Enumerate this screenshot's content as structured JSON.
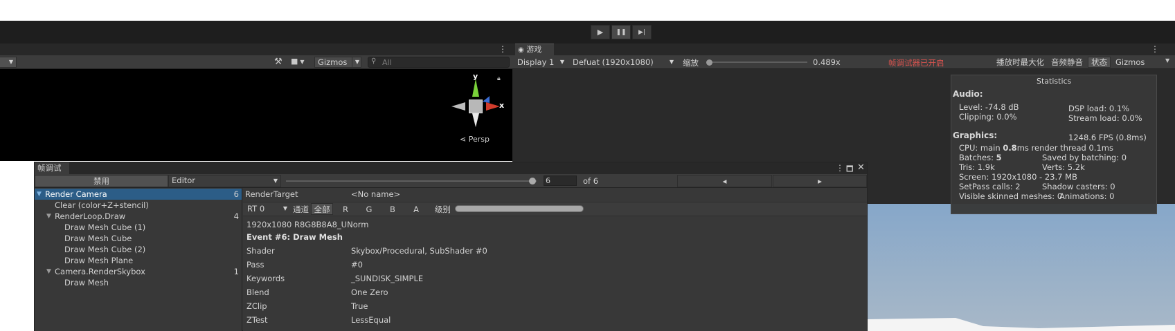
{
  "play_toolbar": {
    "play": "▶",
    "pause": "❚❚",
    "step": "▶|"
  },
  "scene": {
    "gizmos_label": "Gizmos",
    "search_placeholder": "All",
    "axis_y": "y",
    "axis_x": "x",
    "persp_label": "Persp"
  },
  "game": {
    "tab_label": "游戏",
    "display": "Display 1",
    "resolution": "Defuat (1920x1080)",
    "scale_label": "缩放",
    "scale_value": "0.489x",
    "debugger_notice": "帧调试器已开启",
    "maximize": "播放时最大化",
    "mute": "音频静音",
    "stats": "状态",
    "gizmos": "Gizmos",
    "colors": {
      "notice": "#d9534f"
    }
  },
  "statistics": {
    "title": "Statistics",
    "audio_header": "Audio:",
    "level": "Level: -74.8 dB",
    "clipping": "Clipping: 0.0%",
    "dsp_load": "DSP load: 0.1%",
    "stream_load": "Stream load: 0.0%",
    "graphics_header": "Graphics:",
    "fps": "1248.6 FPS (0.8ms)",
    "cpu_prefix": "CPU: main ",
    "cpu_main": "0.8",
    "cpu_suffix": "ms  render thread 0.1ms",
    "batches_prefix": "Batches: ",
    "batches": "5",
    "saved_batching": "Saved by batching: 0",
    "tris": "Tris: 1.9k",
    "verts": "Verts: 5.2k",
    "screen": "Screen: 1920x1080 - 23.7 MB",
    "setpass": "SetPass calls: 2",
    "shadow_casters": "Shadow casters: 0",
    "skinned": "Visible skinned meshes: 0",
    "animations": "Animations: 0"
  },
  "frame_debugger": {
    "tab_label": "帧调试",
    "disable_button": "禁用",
    "target": "Editor",
    "event_index": "6",
    "event_of": "of 6",
    "prev": "◂",
    "next": "▸",
    "tree": [
      {
        "label": "Render Camera",
        "count": "6",
        "indent": 0,
        "expanded": true,
        "selected": true
      },
      {
        "label": "Clear (color+Z+stencil)",
        "count": "",
        "indent": 1,
        "expanded": false,
        "selected": false
      },
      {
        "label": "RenderLoop.Draw",
        "count": "4",
        "indent": 1,
        "expanded": true,
        "selected": false
      },
      {
        "label": "Draw Mesh Cube (1)",
        "count": "",
        "indent": 2,
        "expanded": false,
        "selected": false
      },
      {
        "label": "Draw Mesh Cube",
        "count": "",
        "indent": 2,
        "expanded": false,
        "selected": false
      },
      {
        "label": "Draw Mesh Cube (2)",
        "count": "",
        "indent": 2,
        "expanded": false,
        "selected": false
      },
      {
        "label": "Draw Mesh Plane",
        "count": "",
        "indent": 2,
        "expanded": false,
        "selected": false
      },
      {
        "label": "Camera.RenderSkybox",
        "count": "1",
        "indent": 1,
        "expanded": true,
        "selected": false
      },
      {
        "label": "Draw Mesh",
        "count": "",
        "indent": 2,
        "expanded": false,
        "selected": false
      }
    ],
    "detail": {
      "render_target_label": "RenderTarget",
      "render_target_value": "<No name>",
      "rt_select": "RT 0",
      "channel_label": "通道",
      "channel_all": "全部",
      "ch_r": "R",
      "ch_g": "G",
      "ch_b": "B",
      "ch_a": "A",
      "level_label": "级别",
      "format": "1920x1080 R8G8B8A8_UNorm",
      "event_title": "Event #6: Draw Mesh",
      "rows": [
        {
          "k": "Shader",
          "v": "Skybox/Procedural, SubShader #0"
        },
        {
          "k": "Pass",
          "v": "#0"
        },
        {
          "k": "Keywords",
          "v": "_SUNDISK_SIMPLE"
        },
        {
          "k": "Blend",
          "v": "One Zero"
        },
        {
          "k": "ZClip",
          "v": "True"
        },
        {
          "k": "ZTest",
          "v": "LessEqual"
        }
      ]
    }
  }
}
